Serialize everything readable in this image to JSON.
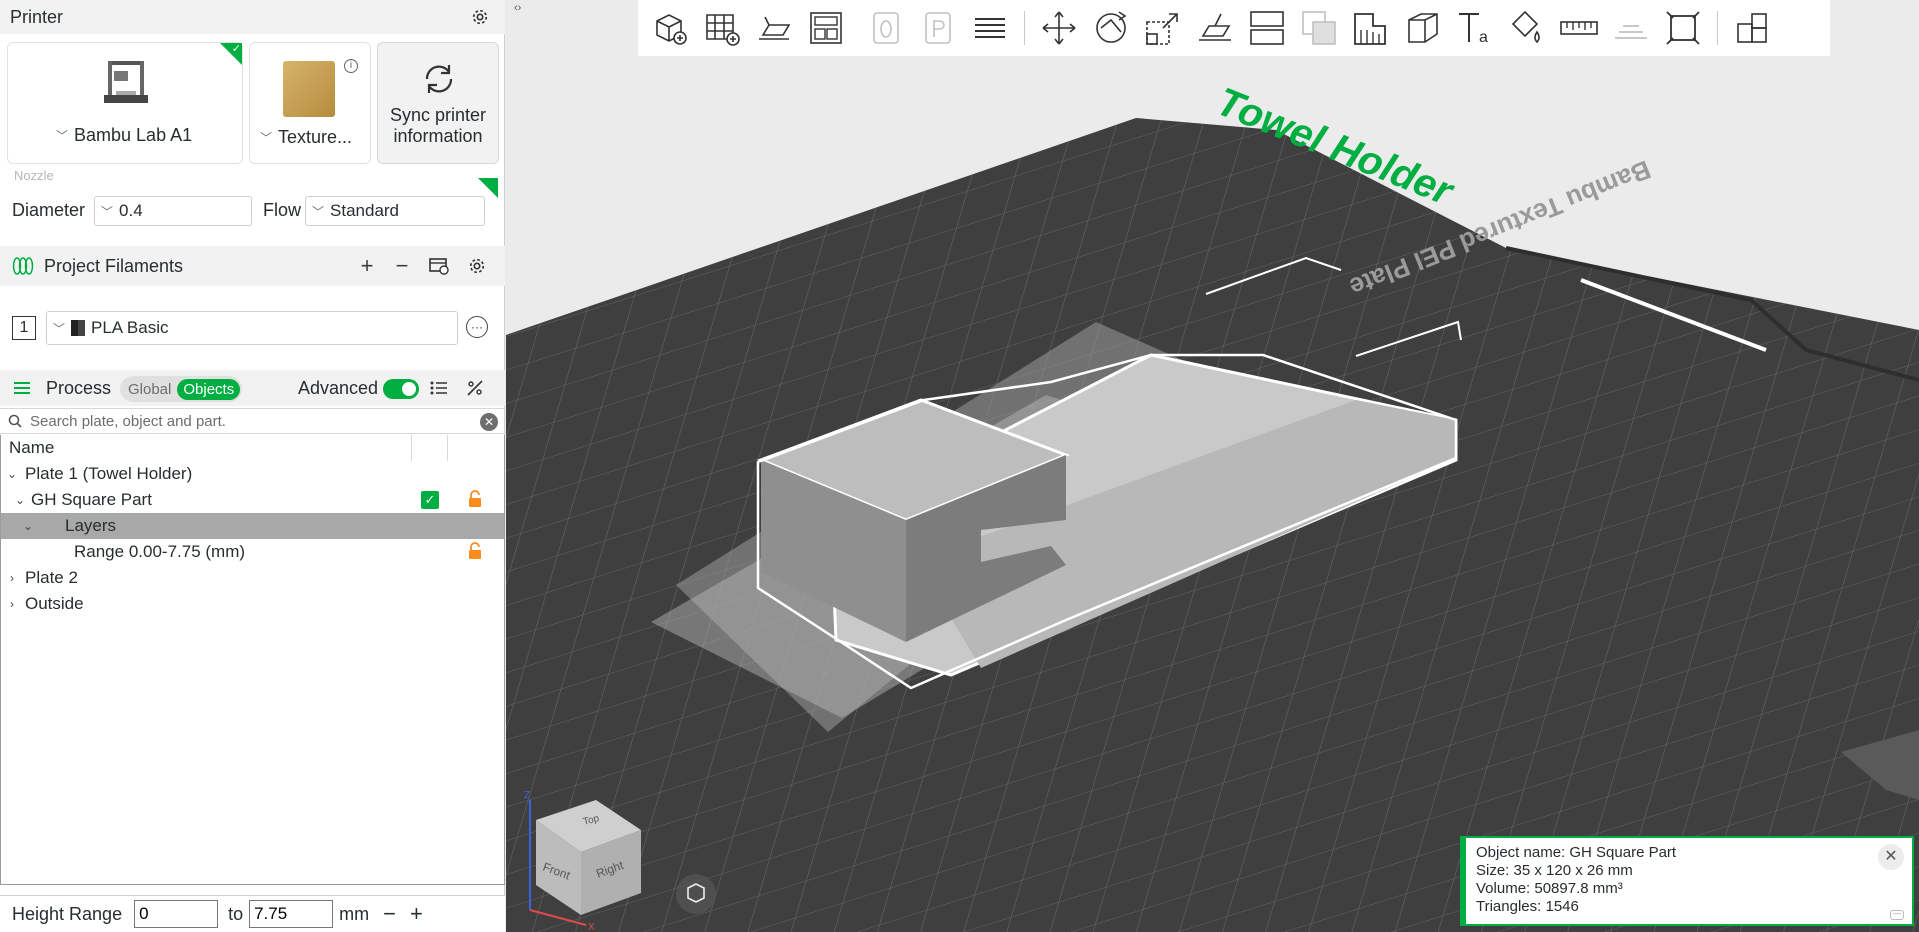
{
  "printer": {
    "title": "Printer",
    "model": "Bambu Lab A1",
    "plate_type": "Texture...",
    "sync_label_line1": "Sync printer",
    "sync_label_line2": "information"
  },
  "nozzle": {
    "section_label": "Nozzle",
    "diameter_label": "Diameter",
    "diameter_value": "0.4",
    "flow_label": "Flow",
    "flow_value": "Standard"
  },
  "filaments": {
    "title": "Project Filaments",
    "items": [
      {
        "index": "1",
        "name": "PLA Basic"
      }
    ]
  },
  "process": {
    "title": "Process",
    "tab_global": "Global",
    "tab_objects": "Objects",
    "advanced_label": "Advanced",
    "advanced_on": true
  },
  "search": {
    "placeholder": "Search plate, object and part."
  },
  "tree": {
    "name_header": "Name",
    "plate1": "Plate 1 (Towel Holder)",
    "part": "GH Square Part",
    "layers": "Layers",
    "range": "Range 0.00-7.75 (mm)",
    "plate2": "Plate 2",
    "outside": "Outside"
  },
  "height_range": {
    "label": "Height Range",
    "from": "0",
    "to_label": "to",
    "to": "7.75",
    "unit": "mm"
  },
  "viewport": {
    "plate_label": "Bambu Textured PEI Plate",
    "project_name": "Towel Holder",
    "cube_top": "Top",
    "cube_front": "Front",
    "cube_right": "Right",
    "axis_z": "Z",
    "axis_x": "X"
  },
  "object_info": {
    "name_line": "Object name: GH Square Part",
    "size_line": "Size: 35 x 120 x 26 mm",
    "volume_line": "Volume: 50897.8 mm³",
    "triangles_line": "Triangles: 1546"
  },
  "colors": {
    "accent": "#00ae42",
    "lock": "#ff8a1e",
    "bed": "#3f3f3f",
    "selection_bar": "#a8a8a8"
  },
  "toolbar_icons": [
    "add-cube-icon",
    "add-plate-icon",
    "auto-orient-icon",
    "arrange-icon",
    "copy-icon",
    "paste-icon",
    "layers-icon",
    "move-icon",
    "rotate-icon",
    "scale-icon",
    "lay-on-face-icon",
    "cut-icon",
    "boolean-icon",
    "support-paint-icon",
    "seam-paint-icon",
    "text-icon",
    "color-paint-icon",
    "measure-icon",
    "assembly-icon",
    "split-view-icon",
    "explode-icon"
  ]
}
